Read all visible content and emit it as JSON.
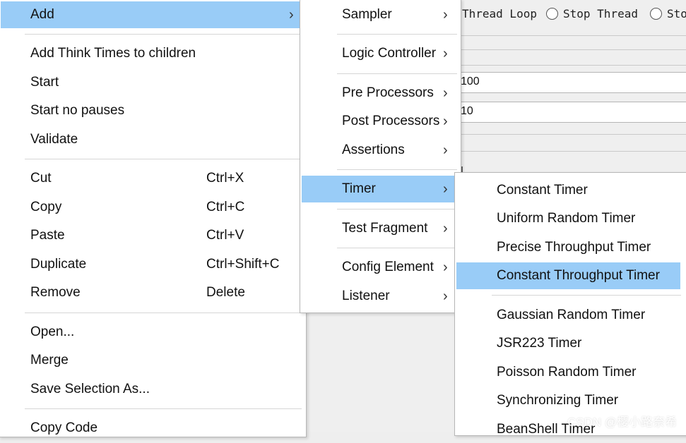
{
  "background": {
    "radios": [
      "Thread Loop",
      "Stop Thread",
      "Sto"
    ],
    "fields": [
      "100",
      "10"
    ]
  },
  "main_menu": {
    "items": [
      {
        "label": "Add",
        "accel": "",
        "submenu": true
      },
      {
        "label": "Add Think Times to children",
        "accel": ""
      },
      {
        "label": "Start",
        "accel": ""
      },
      {
        "label": "Start no pauses",
        "accel": ""
      },
      {
        "label": "Validate",
        "accel": ""
      },
      {
        "label": "Cut",
        "accel": "Ctrl+X"
      },
      {
        "label": "Copy",
        "accel": "Ctrl+C"
      },
      {
        "label": "Paste",
        "accel": "Ctrl+V"
      },
      {
        "label": "Duplicate",
        "accel": "Ctrl+Shift+C"
      },
      {
        "label": "Remove",
        "accel": "Delete"
      },
      {
        "label": "Open...",
        "accel": ""
      },
      {
        "label": "Merge",
        "accel": ""
      },
      {
        "label": "Save Selection As...",
        "accel": ""
      },
      {
        "label": "Copy Code",
        "accel": ""
      }
    ]
  },
  "add_menu": {
    "items": [
      {
        "label": "Sampler"
      },
      {
        "label": "Logic Controller"
      },
      {
        "label": "Pre Processors"
      },
      {
        "label": "Post Processors"
      },
      {
        "label": "Assertions"
      },
      {
        "label": "Timer"
      },
      {
        "label": "Test Fragment"
      },
      {
        "label": "Config Element"
      },
      {
        "label": "Listener"
      }
    ]
  },
  "timer_menu": {
    "items": [
      {
        "label": "Constant Timer"
      },
      {
        "label": "Uniform Random Timer"
      },
      {
        "label": "Precise Throughput Timer"
      },
      {
        "label": "Constant Throughput Timer"
      },
      {
        "label": "Gaussian Random Timer"
      },
      {
        "label": "JSR223 Timer"
      },
      {
        "label": "Poisson Random Timer"
      },
      {
        "label": "Synchronizing Timer"
      },
      {
        "label": "BeanShell Timer"
      }
    ]
  },
  "icons": {
    "submenu_arrow": "›"
  },
  "colors": {
    "highlight": "#99ccf7"
  },
  "watermark": "CSDN @樱小路奈希"
}
